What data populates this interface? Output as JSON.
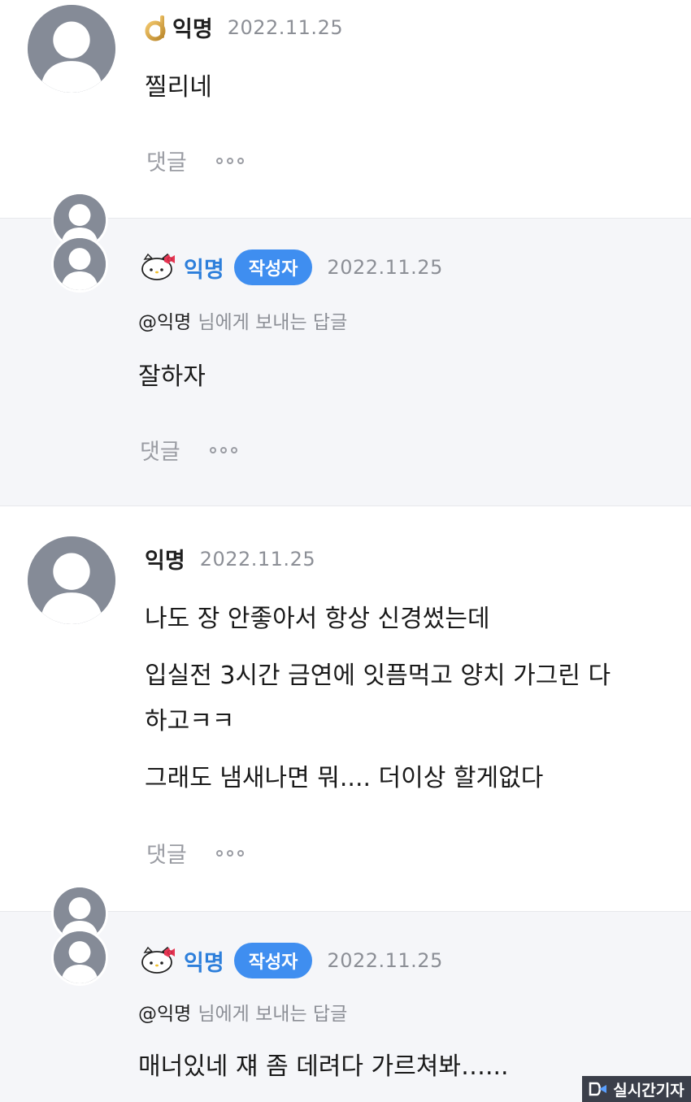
{
  "comments": [
    {
      "author": "익명",
      "date": "2022.11.25",
      "lines": [
        "찔리네"
      ],
      "reply_label": "댓글"
    },
    {
      "author": "익명",
      "badge": "작성자",
      "date": "2022.11.25",
      "reply_to_name": "@익명",
      "reply_to_suffix": "님에게 보내는 답글",
      "lines": [
        "잘하자"
      ],
      "reply_label": "댓글"
    },
    {
      "author": "익명",
      "date": "2022.11.25",
      "lines": [
        "나도 장 안좋아서 항상 신경썼는데",
        "입실전 3시간 금연에 잇픔먹고 양치 가그린 다",
        "하고ㅋㅋ",
        "그래도 냄새나면 뭐.... 더이상 할게없다"
      ],
      "reply_label": "댓글"
    },
    {
      "author": "익명",
      "badge": "작성자",
      "date": "2022.11.25",
      "reply_to_name": "@익명",
      "reply_to_suffix": "님에게 보내는 답글",
      "lines": [
        "매너있네 쟤 좀 데려다 가르쳐봐…..."
      ]
    }
  ],
  "icons": {
    "level": "level-d-icon",
    "author_flair": "hello-kitty-icon",
    "more": "more-dots-icon",
    "avatar": "default-user-avatar"
  },
  "colors": {
    "accent": "#3f8ef0",
    "author_name": "#2d7fdb",
    "reply_bg": "#f5f6f9",
    "muted": "#8c8f96"
  },
  "watermark": {
    "text": "실시간기자"
  }
}
